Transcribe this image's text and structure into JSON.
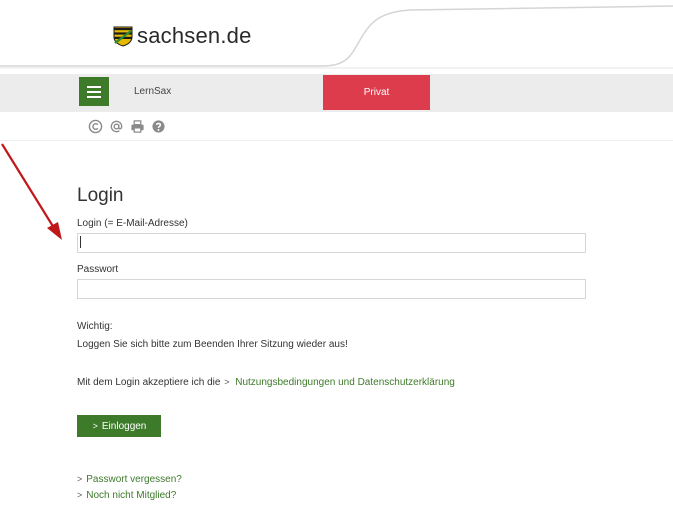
{
  "header": {
    "logo_text": "sachsen.de",
    "logo_icon": "saxony-crest-icon"
  },
  "navbar": {
    "menu_icon": "hamburger-menu-icon",
    "title": "LernSax",
    "privat_tab": "Privat"
  },
  "toolbar": {
    "icons": [
      "copyright-icon",
      "at-icon",
      "print-icon",
      "help-icon"
    ]
  },
  "login": {
    "title": "Login",
    "email_label": "Login (= E-Mail-Adresse)",
    "email_value": "",
    "password_label": "Passwort",
    "password_value": ""
  },
  "notice": {
    "title": "Wichtig:",
    "text": "Loggen Sie sich bitte zum Beenden Ihrer Sitzung wieder aus!"
  },
  "terms": {
    "prefix": "Mit dem Login akzeptiere ich die",
    "link": "Nutzungsbedingungen und Datenschutzerklärung"
  },
  "submit": {
    "label": "Einloggen"
  },
  "links": {
    "forgot_password": "Passwort vergessen?",
    "not_member": "Noch nicht Mitglied?"
  },
  "colors": {
    "brand_green": "#3d7a2a",
    "privat_red": "#dc3c4b",
    "annotation_arrow": "#c0181a"
  }
}
